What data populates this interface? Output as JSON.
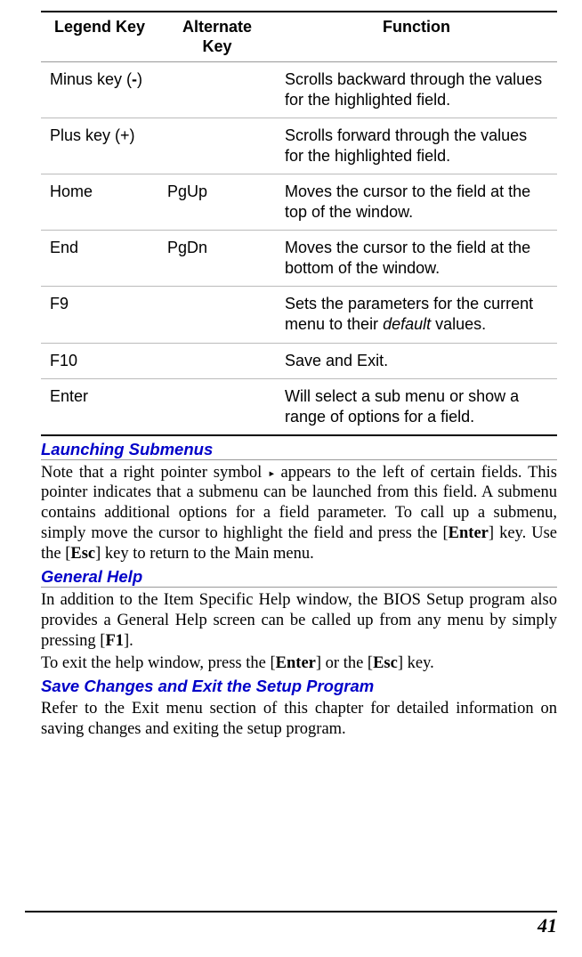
{
  "table": {
    "headers": {
      "legend": "Legend Key",
      "alternate_line1": "Alternate",
      "alternate_line2": "Key",
      "function": "Function"
    },
    "rows": [
      {
        "legend_pre": "Minus key (",
        "legend_bold": "-",
        "legend_post": ")",
        "alt": "",
        "func": "Scrolls backward through the values for the highlighted field."
      },
      {
        "legend_pre": "Plus key (+)",
        "legend_bold": "",
        "legend_post": "",
        "alt": "",
        "func": "Scrolls forward through the values for the highlighted field."
      },
      {
        "legend_pre": "Home",
        "legend_bold": "",
        "legend_post": "",
        "alt": "PgUp",
        "func": "Moves the cursor to the field at the top of the window."
      },
      {
        "legend_pre": "End",
        "legend_bold": "",
        "legend_post": "",
        "alt": "PgDn",
        "func": "Moves the cursor to the field at the bottom of the window."
      },
      {
        "legend_pre": "F9",
        "legend_bold": "",
        "legend_post": "",
        "alt": "",
        "func_pre": "Sets the parameters for the current menu to their ",
        "func_italic": "default",
        "func_post": " values."
      },
      {
        "legend_pre": "F10",
        "legend_bold": "",
        "legend_post": "",
        "alt": "",
        "func": "Save and Exit."
      },
      {
        "legend_pre": "Enter",
        "legend_bold": "",
        "legend_post": "",
        "alt": "",
        "func": "Will select a sub menu or show a range of options for a field."
      }
    ]
  },
  "sections": {
    "launching": {
      "title": "Launching Submenus",
      "para_pre": "Note that a right pointer symbol ",
      "para_post": " appears to the left of certain fields. This pointer indicates that a submenu can be launched from this field. A submenu contains additional options for a field parameter. To call up a submenu, simply move the cursor to highlight the field and press the [",
      "key1": "Enter",
      "para_mid": "] key. Use the [",
      "key2": "Esc",
      "para_end": "] key to return to the Main menu."
    },
    "general": {
      "title": "General Help",
      "p1_pre": "In addition to the Item Specific Help window, the BIOS Setup program also provides a General Help screen can be called up from any menu by simply pressing [",
      "p1_key": "F1",
      "p1_post": "].",
      "p2_pre": "To exit the help window, press the [",
      "p2_key1": "Enter",
      "p2_mid": "] or the [",
      "p2_key2": "Esc",
      "p2_post": "] key."
    },
    "save": {
      "title": "Save Changes and Exit the Setup Program",
      "para": "Refer to the Exit menu section of this chapter for detailed information on saving changes and exiting the setup program."
    }
  },
  "page_number": "41"
}
